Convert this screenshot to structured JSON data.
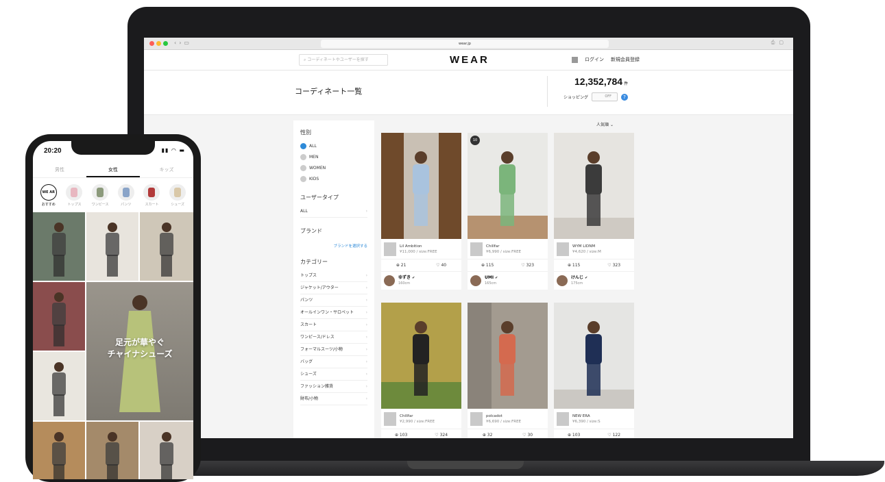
{
  "browser": {
    "url": "wear.jp"
  },
  "site": {
    "search_placeholder": "コーディネートやユーザーを探す",
    "logo": "WEAR",
    "login": "ログイン",
    "register": "新規会員登録"
  },
  "page": {
    "title": "コーディネート一覧",
    "count": "12,352,784",
    "count_unit": "件",
    "shopping_label": "ショッピング",
    "shopping_toggle": "OFF",
    "help": "?",
    "sort": "人気順"
  },
  "sidebar": {
    "gender_heading": "性別",
    "genders": [
      "ALL",
      "MEN",
      "WOMEN",
      "KIDS"
    ],
    "user_type_heading": "ユーザータイプ",
    "user_type_value": "ALL",
    "brand_heading": "ブランド",
    "brand_link": "ブランドを選択する",
    "category_heading": "カテゴリー",
    "categories": [
      "トップス",
      "ジャケット/アウター",
      "パンツ",
      "オールインワン・サロペット",
      "スカート",
      "ワンピース/ドレス",
      "フォーマルスーツ/小物",
      "バッグ",
      "シューズ",
      "ファッション雑貨",
      "財布/小物"
    ]
  },
  "cards": [
    {
      "rank": "",
      "brand": "Lil Ambition",
      "price": "¥11,000 / size:FREE",
      "saves": "21",
      "likes": "40",
      "user": "ゆずき",
      "height": "160cm"
    },
    {
      "rank": "10",
      "brand": "Chillfar",
      "price": "¥6,990 / size:FREE",
      "saves": "115",
      "likes": "323",
      "user": "UMI",
      "height": "165cm"
    },
    {
      "rank": "",
      "brand": "WYM LIDNM",
      "price": "¥4,620 / size:M",
      "saves": "115",
      "likes": "323",
      "user": "けんじ",
      "height": "175cm"
    },
    {
      "rank": "",
      "brand": "Chillfar",
      "price": "¥2,990 / size:FREE",
      "saves": "103",
      "likes": "324",
      "user": "",
      "height": ""
    },
    {
      "rank": "",
      "brand": "polcadot",
      "price": "¥6,690 / size:FREE",
      "saves": "32",
      "likes": "30",
      "user": "",
      "height": ""
    },
    {
      "rank": "",
      "brand": "NEW ERA",
      "price": "¥6,390 / size:S",
      "saves": "103",
      "likes": "122",
      "user": "",
      "height": ""
    }
  ],
  "phone": {
    "time": "20:20",
    "tabs": [
      "男性",
      "女性",
      "キッズ"
    ],
    "active_tab": "女性",
    "categories": [
      "おすすめ",
      "トップス",
      "ワンピース",
      "パンツ",
      "スカート",
      "シューズ"
    ],
    "wear_badge": "WE AR",
    "feature_line1": "足元が華やぐ",
    "feature_line2": "チャイナシューズ"
  }
}
